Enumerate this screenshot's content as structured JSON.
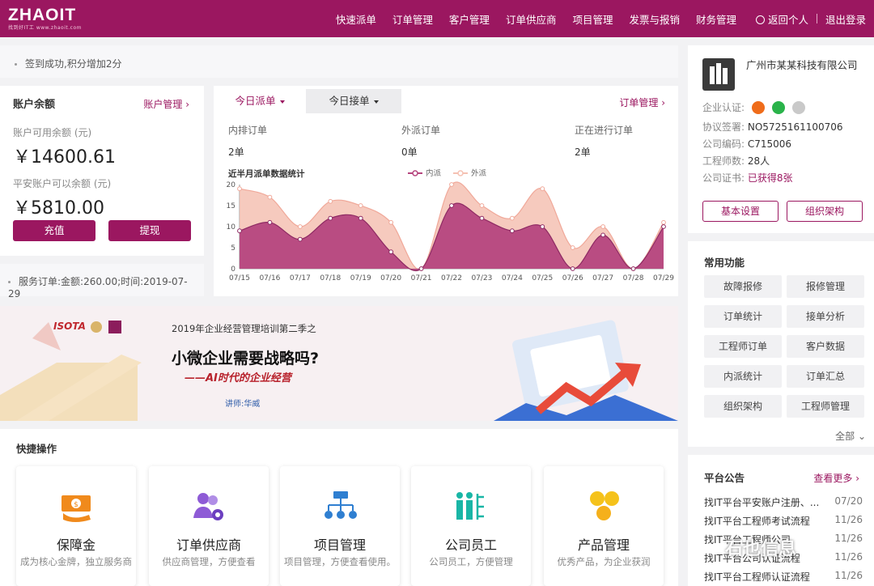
{
  "brand": {
    "logo": "ZHAOIT",
    "tagline": "找到好IT工 www.zhaoit.com"
  },
  "nav": [
    "快速派单",
    "订单管理",
    "客户管理",
    "订单供应商",
    "项目管理",
    "发票与报销",
    "财务管理"
  ],
  "user": {
    "back": "返回个人",
    "logout": "退出登录"
  },
  "notice": "签到成功,积分增加2分",
  "balance": {
    "title": "账户余额",
    "manage": "账户管理",
    "available_label": "账户可用余额 (元)",
    "available_value": "￥14600.61",
    "pingan_label": "平安账户可以余额 (元)",
    "pingan_value": "￥5810.00",
    "recharge": "充值",
    "withdraw": "提现"
  },
  "order_note": "服务订单:金额:260.00;时间:2019-07-29",
  "orders": {
    "tab_dispatch": "今日派单",
    "tab_receive": "今日接单",
    "manage": "订单管理",
    "stats": [
      {
        "label": "内排订单",
        "value": "2单"
      },
      {
        "label": "外派订单",
        "value": "0单"
      },
      {
        "label": "正在进行订单",
        "value": "2单"
      }
    ]
  },
  "chart_data": {
    "type": "area",
    "title": "近半月派单数据统计",
    "x": [
      "07/15",
      "07/16",
      "07/17",
      "07/18",
      "07/19",
      "07/20",
      "07/21",
      "07/22",
      "07/23",
      "07/24",
      "07/25",
      "07/26",
      "07/27",
      "07/28",
      "07/29"
    ],
    "series": [
      {
        "name": "内派",
        "values": [
          9,
          11,
          7,
          12,
          12,
          4,
          0,
          15,
          12,
          9,
          10,
          0,
          8,
          0,
          10
        ],
        "color": "#b5457e"
      },
      {
        "name": "外派",
        "values": [
          19,
          17,
          10,
          16,
          15,
          11,
          0,
          20,
          15,
          12,
          19,
          5,
          10,
          0,
          11
        ],
        "color": "#f5c1b3"
      }
    ],
    "ylim": [
      0,
      20
    ],
    "yticks": [
      0,
      5,
      10,
      15,
      20
    ],
    "legend": "top"
  },
  "banner": {
    "org": "ISOTA",
    "subtitle": "2019年企业经营管理培训第二季之",
    "headline": "小微企业需要战略吗?",
    "tagline": "——AI时代的企业经营",
    "speaker": "讲师:华威"
  },
  "quick": {
    "title": "快捷操作",
    "items": [
      {
        "title": "保障金",
        "desc": "成为核心金牌，独立服务商",
        "icon": "money-icon",
        "color": "#f08a1c"
      },
      {
        "title": "订单供应商",
        "desc": "供应商管理，方便查看",
        "icon": "supplier-icon",
        "color": "#8e5bd6"
      },
      {
        "title": "项目管理",
        "desc": "项目管理，方便查看使用。",
        "icon": "org-tree-icon",
        "color": "#2f7fd1"
      },
      {
        "title": "公司员工",
        "desc": "公司员工，方便管理",
        "icon": "staff-icon",
        "color": "#19b6a6"
      },
      {
        "title": "产品管理",
        "desc": "优秀产品，为企业获润",
        "icon": "coins-icon",
        "color": "#f5c21b"
      }
    ]
  },
  "company": {
    "name": "广州市某某科技有限公司",
    "cert_label": "企业认证:",
    "agreement_label": "协议签署:",
    "agreement_value": "NO5725161100706",
    "code_label": "公司编码:",
    "code_value": "C715006",
    "engineers_label": "工程师数:",
    "engineers_value": "28人",
    "cert_book_label": "公司证书:",
    "cert_book_value": "已获得8张",
    "btn_basic": "基本设置",
    "btn_org": "组织架构"
  },
  "funcs": {
    "title": "常用功能",
    "items": [
      "故障报修",
      "报修管理",
      "订单统计",
      "接单分析",
      "工程师订单",
      "客户数据",
      "内派统计",
      "订单汇总",
      "组织架构",
      "工程师管理"
    ],
    "all": "全部"
  },
  "announce": {
    "title": "平台公告",
    "more": "查看更多",
    "items": [
      {
        "title": "找IT平台平安账户注册、...",
        "date": "07/20"
      },
      {
        "title": "找IT平台工程师考试流程",
        "date": "11/26"
      },
      {
        "title": "找IT平台工程师公司",
        "date": "11/26"
      },
      {
        "title": "找IT平台公司认证流程",
        "date": "11/26"
      },
      {
        "title": "找IT平台工程师认证流程",
        "date": "11/26"
      }
    ]
  },
  "watermark": "石也信息"
}
